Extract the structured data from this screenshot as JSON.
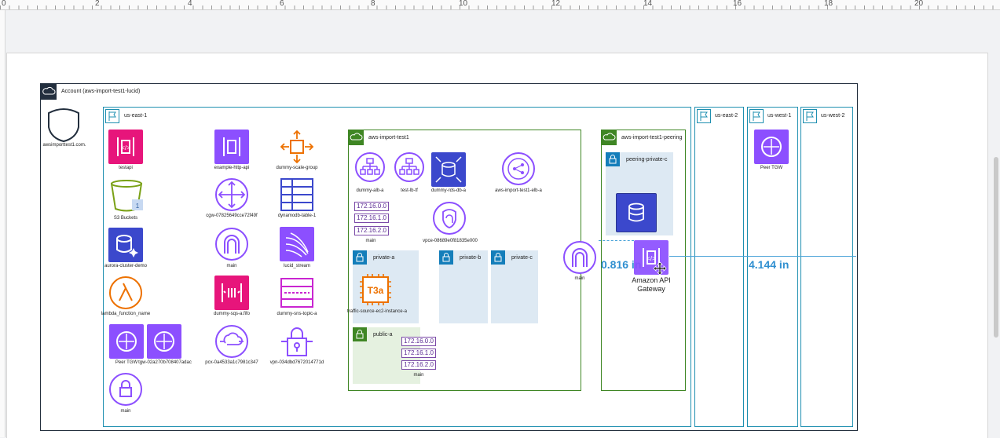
{
  "ruler": {
    "marks": [
      "0",
      "2",
      "4",
      "6",
      "8",
      "10",
      "12",
      "14",
      "16",
      "18",
      "20"
    ]
  },
  "account": {
    "title": "Account (aws-import-test1-lucid)",
    "dns_label": "awsimporttest1.com."
  },
  "regions": {
    "us_east_1": "us-east-1",
    "us_east_2": "us-east-2",
    "us_west_1": "us-west-1",
    "us_west_2": "us-west-2"
  },
  "services": {
    "testapi": "testapi",
    "example_http_api": "example-http-api",
    "dummy_scale_group": "dummy-scale-group",
    "s3_buckets": "S3 Buckets",
    "s3_badge": "1",
    "cgw": "cgw-07825649cce72f49f",
    "dynamodb_table": "dynamodb-table-1",
    "aurora_cluster": "aurora-cluster-demo",
    "igw_main": "main",
    "lucid_stream": "lucid_stream",
    "lambda": "lambda_function_name",
    "dummy_sqs": "dummy-sqs-a.fifo",
    "dummy_sns": "dummy-sns-topic-a",
    "peer_tgw": "Peer TGW",
    "tgw": "tgw-02a270b708407adac",
    "pcx": "pcx-0a4533a1c7981c347",
    "vpn": "vpn-034dbd7672014771d",
    "vgw_main": "main"
  },
  "vpc1": {
    "name": "aws-import-test1",
    "alb_a": "dummy-alb-a",
    "lb_tf": "test-lb-tf",
    "rds": "dummy-rds-db-a",
    "elb": "aws-import-test1-elb-a",
    "cidrs": [
      "172.16.0.0",
      "172.16.1.0",
      "172.16.2.0"
    ],
    "rt_main": "main",
    "vpce": "vpce-08689e0f81835e000",
    "subnets": {
      "private_a": "private-a",
      "private_b": "private-b",
      "private_c": "private-c",
      "public_a": "public-a"
    },
    "ec2_chip": "T3a",
    "ec2": "traffic-source-ec2-instance-a",
    "pub_cidrs": [
      "172.16.0.0",
      "172.16.1.0",
      "172.16.2.0"
    ],
    "pub_rt_main": "main"
  },
  "between": {
    "igw_main": "main"
  },
  "vpc2": {
    "name": "aws-import-test1-peering",
    "subnet": "peering-private-c"
  },
  "us_west_1": {
    "peer_tgw": "Peer TGW"
  },
  "selection": {
    "label": "Amazon API Gateway"
  },
  "measurements": {
    "left": "0.816 in",
    "right": "4.144 in"
  },
  "colors": {
    "purple": "#8c4fff",
    "red": "#e7157b",
    "green": "#7aa116",
    "orange": "#ed7100",
    "pink": "#c925d1",
    "region": "#1e8fb0",
    "vpc": "#3f8624",
    "account": "#232f3e",
    "measure": "#4aa3d8"
  }
}
